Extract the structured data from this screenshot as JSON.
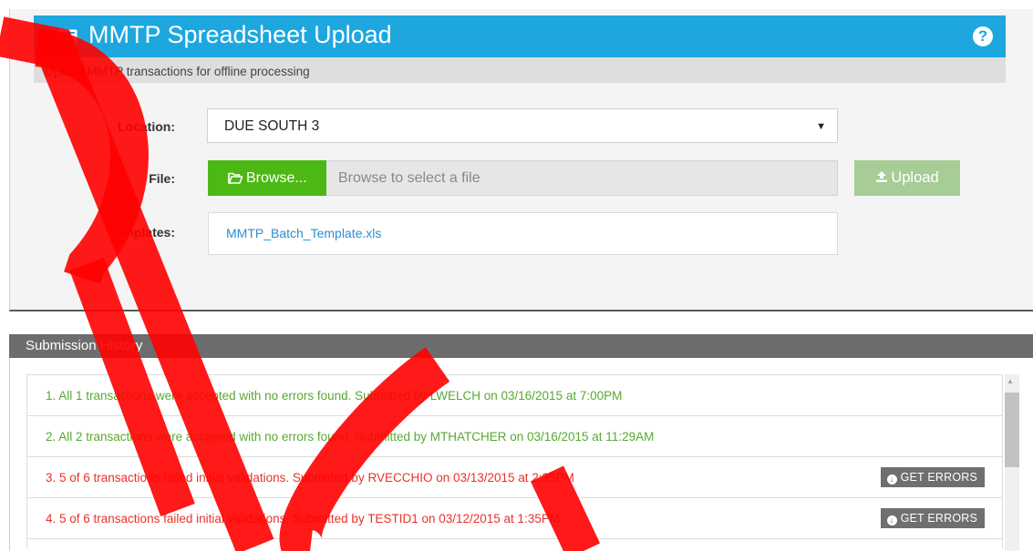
{
  "header": {
    "title": "MMTP Spreadsheet Upload",
    "subtitle": "Upload MMTP transactions for offline processing",
    "help_icon": "question-circle-icon",
    "title_icon": "list-doc-icon",
    "accent_color": "#1ea7df"
  },
  "form": {
    "location_label": "Location:",
    "location_value": "DUE SOUTH 3",
    "file_label": "File:",
    "browse_label": "Browse...",
    "file_placeholder": "Browse to select a file",
    "upload_label": "Upload",
    "templates_label": "Templates:",
    "template_link": "MMTP_Batch_Template.xls",
    "browse_color": "#4cb814",
    "upload_color": "#a8cc96"
  },
  "history": {
    "header": "Submission History",
    "get_errors_label": "GET ERRORS",
    "rows": [
      {
        "text": "1. All 1 transactions were accepted with no errors found. Submitted by LWELCH on 03/16/2015 at 7:00PM",
        "status": "ok"
      },
      {
        "text": "2. All 2 transactions were accepted with no errors found. Submitted by MTHATCHER on 03/16/2015 at 11:29AM",
        "status": "ok"
      },
      {
        "text": "3. 5 of 6 transactions failed initial validations. Submitted by RVECCHIO on 03/13/2015 at 2:35PM",
        "status": "err"
      },
      {
        "text": "4. 5 of 6 transactions failed initial validations. Submitted by TESTID1 on 03/12/2015 at 1:35PM",
        "status": "err"
      }
    ]
  },
  "watermark": {
    "text": "RC",
    "color": "#ff0000"
  }
}
